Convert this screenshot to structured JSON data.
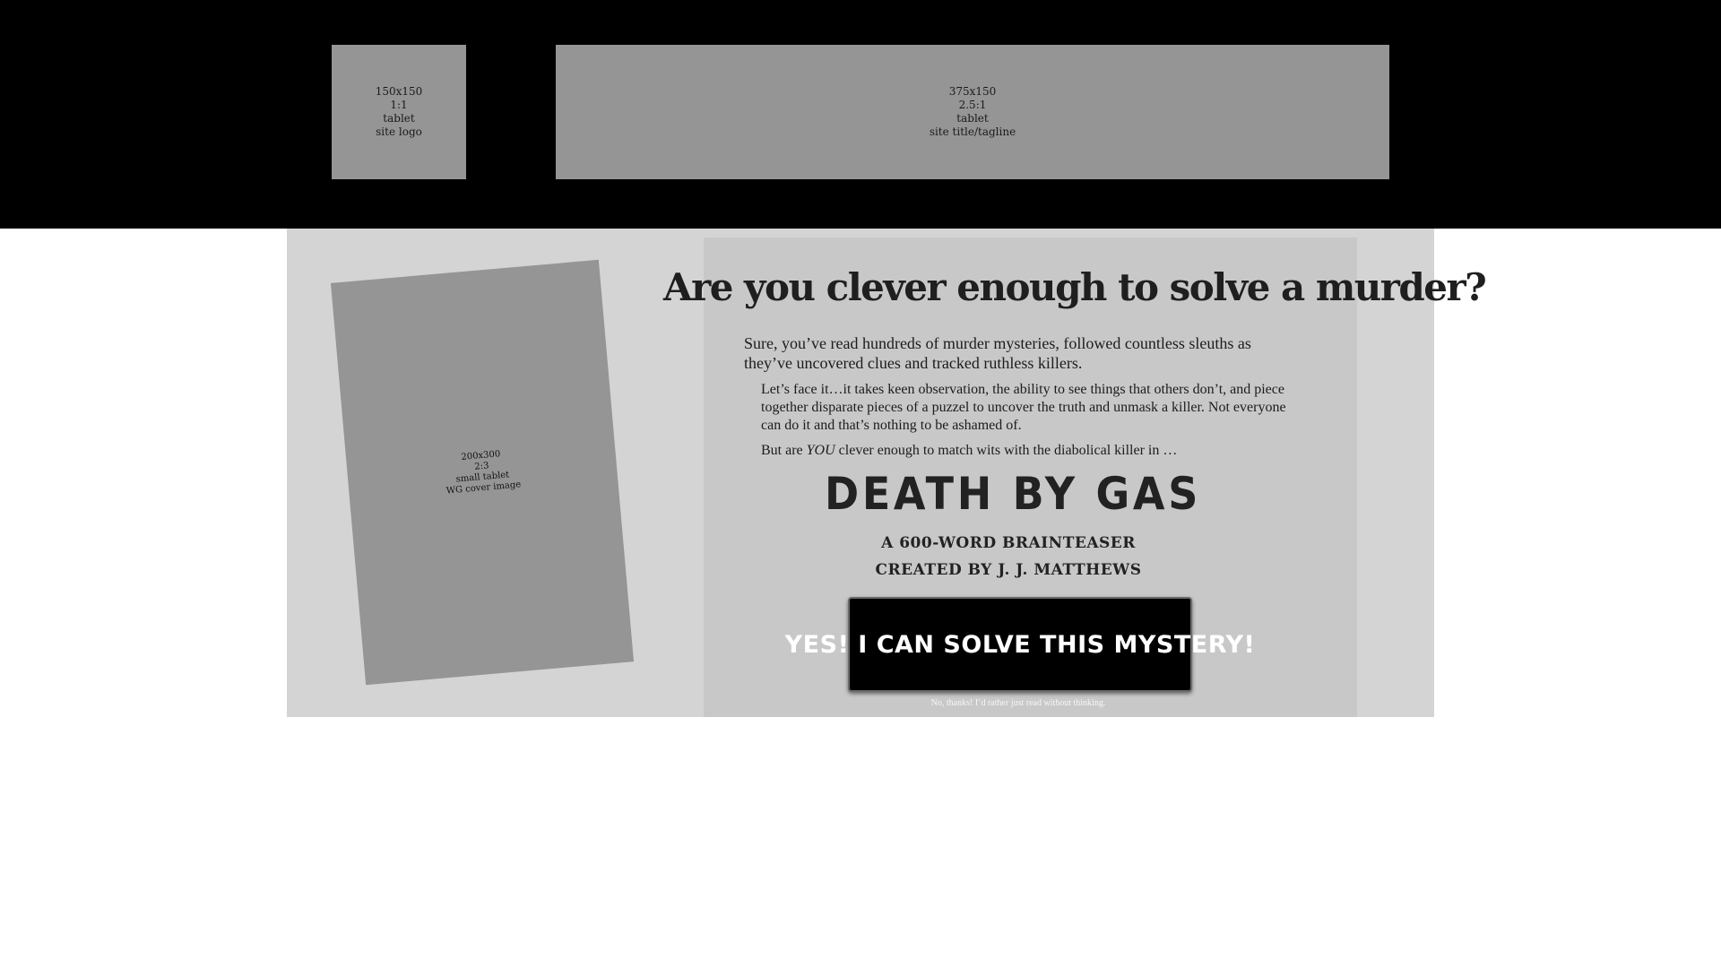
{
  "header": {
    "logo_placeholder": {
      "size": "150x150",
      "ratio": "1:1",
      "device": "tablet",
      "purpose": "site logo"
    },
    "title_placeholder": {
      "size": "375x150",
      "ratio": "2.5:1",
      "device": "tablet",
      "purpose": "site title/tagline"
    }
  },
  "cover_placeholder": {
    "size": "200x300",
    "ratio": "2:3",
    "device": "small tablet",
    "purpose": "WG cover image"
  },
  "main": {
    "headline": "Are you clever enough to solve a murder?",
    "intro": "Sure, you’ve read hundreds of murder mysteries, followed countless sleuths as they’ve uncovered clues and tracked ruthless killers.",
    "paragraph1": "Let’s face it…it takes keen observation, the ability to see things that others don’t, and piece together disparate pieces of a puzzel to uncover the truth and unmask a killer. Not everyone can do it and that’s nothing to be ashamed of.",
    "paragraph2_start": "But are ",
    "paragraph2_emphasis": "YOU",
    "paragraph2_end": " clever enough to match wits with the diabolical killer in  …",
    "book_title": "DEATH BY GAS",
    "subtitle_line1": "A 600-word brainteaser",
    "subtitle_line2": "created by J. J. Matthews",
    "cta_label": "YES! I CAN SOLVE THIS MYSTERY!",
    "decline_label": "No, thanks! I’d rather just read without thinking."
  },
  "colors": {
    "header_bg": "#000000",
    "placeholder_bg": "#959595",
    "section_bg": "#d4d4d4",
    "panel_bg": "#c8c8c8",
    "button_bg": "#000000",
    "button_text": "#ffffff"
  }
}
